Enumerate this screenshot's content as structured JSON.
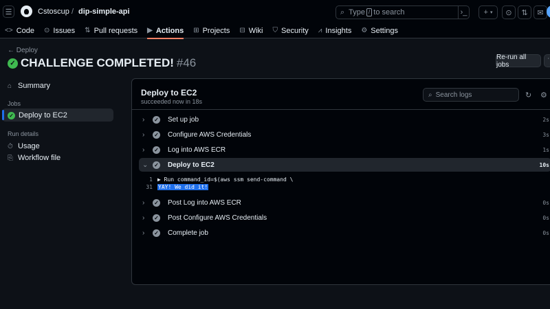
{
  "header": {
    "owner": "Cstoscup",
    "separator": "/",
    "repo": "dip-simple-api",
    "search_prefix": "Type",
    "search_key": "/",
    "search_suffix": "to search"
  },
  "tabs": [
    {
      "label": "Code",
      "icon": "<>"
    },
    {
      "label": "Issues",
      "icon": "⊙"
    },
    {
      "label": "Pull requests",
      "icon": "⇅"
    },
    {
      "label": "Actions",
      "icon": "▶"
    },
    {
      "label": "Projects",
      "icon": "⊞"
    },
    {
      "label": "Wiki",
      "icon": "⊟"
    },
    {
      "label": "Security",
      "icon": "⛉"
    },
    {
      "label": "Insights",
      "icon": "⩘"
    },
    {
      "label": "Settings",
      "icon": "⚙"
    }
  ],
  "run": {
    "back_label": "Deploy",
    "title": "CHALLENGE COMPLETED!",
    "run_number": "#46",
    "rerun_label": "Re-run all jobs"
  },
  "sidebar": {
    "summary": "Summary",
    "jobs_heading": "Jobs",
    "job": "Deploy to EC2",
    "run_details_heading": "Run details",
    "usage": "Usage",
    "workflow_file": "Workflow file"
  },
  "job_panel": {
    "title": "Deploy to EC2",
    "subtitle": "succeeded now in 18s",
    "search_placeholder": "Search logs"
  },
  "steps": [
    {
      "name": "Set up job",
      "duration": "2s"
    },
    {
      "name": "Configure AWS Credentials",
      "duration": "3s"
    },
    {
      "name": "Log into AWS ECR",
      "duration": "1s"
    },
    {
      "name": "Deploy to EC2",
      "duration": "10s"
    },
    {
      "name": "Post Log into AWS ECR",
      "duration": "0s"
    },
    {
      "name": "Post Configure AWS Credentials",
      "duration": "0s"
    },
    {
      "name": "Complete job",
      "duration": "0s"
    }
  ],
  "log_lines": [
    {
      "line": "1",
      "text": "▶ Run command_id=$(aws ssm send-command \\"
    },
    {
      "line": "31",
      "text": "YAY! We did it!"
    }
  ],
  "colors": {
    "background": "#0d1117",
    "success": "#3fb950",
    "accent": "#1f6feb",
    "active_tab": "#f78166"
  }
}
